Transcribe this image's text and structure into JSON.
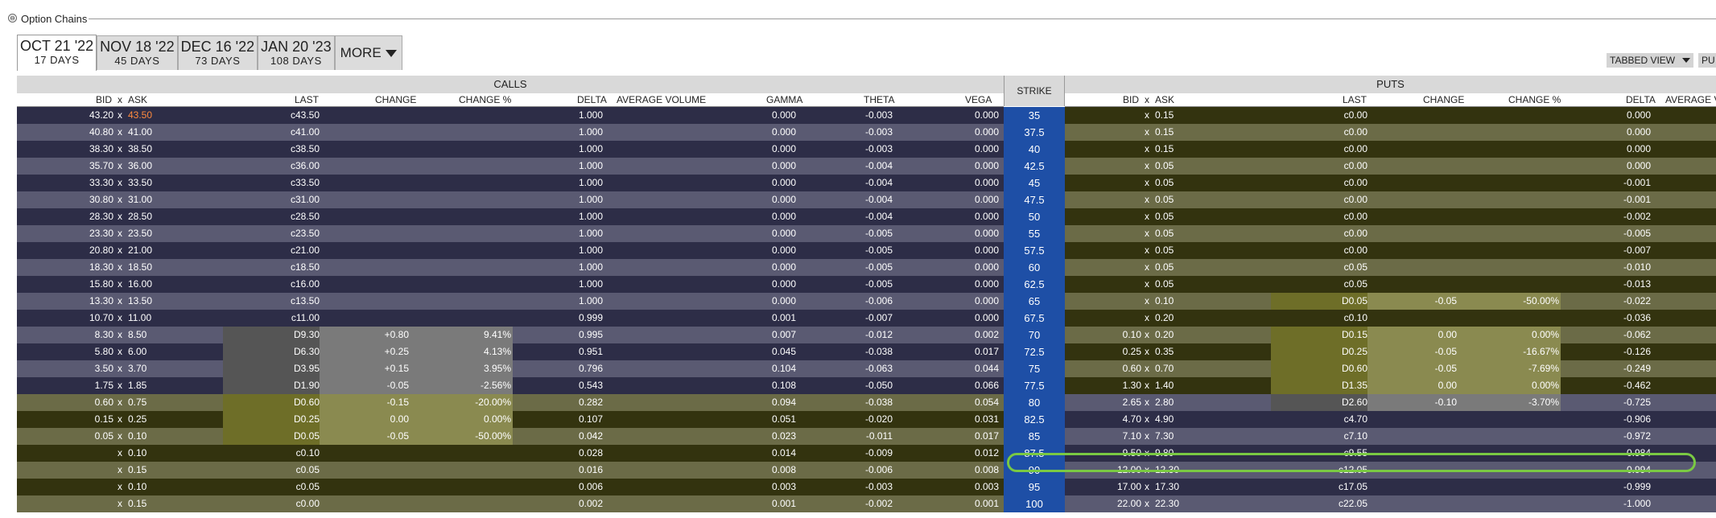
{
  "panel": {
    "title": "Option Chains",
    "collapse_glyph": "⊖"
  },
  "tabs": [
    {
      "date": "OCT 21 '22",
      "days": "17 DAYS",
      "active": true
    },
    {
      "date": "NOV 18 '22",
      "days": "45 DAYS",
      "active": false
    },
    {
      "date": "DEC 16 '22",
      "days": "73 DAYS",
      "active": false
    },
    {
      "date": "JAN 20 '23",
      "days": "108 DAYS",
      "active": false
    }
  ],
  "more_label": "MORE",
  "view_select": {
    "value": "TABBED VIEW",
    "second": "PU"
  },
  "headers": {
    "calls": "CALLS",
    "puts": "PUTS",
    "strike": "STRIKE",
    "bid": "BID",
    "x": "x",
    "ask": "ASK",
    "last": "LAST",
    "change": "CHANGE",
    "change_pct": "CHANGE %",
    "delta": "DELTA",
    "avg_volume": "AVERAGE VOLUME",
    "gamma": "GAMMA",
    "theta": "THETA",
    "vega": "VEGA",
    "puts_avg_volume": "AVERAGE V"
  },
  "colors": {
    "strike": "#1e4fa6",
    "highlight_oval": "#7ac943",
    "ask_highlight": "#ff8a3d"
  },
  "rows": [
    {
      "strike": "35",
      "c": {
        "bid": "43.20",
        "ask": "43.50",
        "last": "c43.50",
        "chg": "",
        "pct": "",
        "delta": "1.000",
        "gamma": "0.000",
        "theta": "-0.003",
        "vega": "0.000"
      },
      "p": {
        "bid": "",
        "ask": "0.15",
        "last": "c0.00",
        "chg": "",
        "pct": "",
        "delta": "0.000"
      }
    },
    {
      "strike": "37.5",
      "c": {
        "bid": "40.80",
        "ask": "41.00",
        "last": "c41.00",
        "chg": "",
        "pct": "",
        "delta": "1.000",
        "gamma": "0.000",
        "theta": "-0.003",
        "vega": "0.000"
      },
      "p": {
        "bid": "",
        "ask": "0.15",
        "last": "c0.00",
        "chg": "",
        "pct": "",
        "delta": "0.000"
      }
    },
    {
      "strike": "40",
      "c": {
        "bid": "38.30",
        "ask": "38.50",
        "last": "c38.50",
        "chg": "",
        "pct": "",
        "delta": "1.000",
        "gamma": "0.000",
        "theta": "-0.003",
        "vega": "0.000"
      },
      "p": {
        "bid": "",
        "ask": "0.15",
        "last": "c0.00",
        "chg": "",
        "pct": "",
        "delta": "0.000"
      }
    },
    {
      "strike": "42.5",
      "c": {
        "bid": "35.70",
        "ask": "36.00",
        "last": "c36.00",
        "chg": "",
        "pct": "",
        "delta": "1.000",
        "gamma": "0.000",
        "theta": "-0.004",
        "vega": "0.000"
      },
      "p": {
        "bid": "",
        "ask": "0.05",
        "last": "c0.00",
        "chg": "",
        "pct": "",
        "delta": "0.000"
      }
    },
    {
      "strike": "45",
      "c": {
        "bid": "33.30",
        "ask": "33.50",
        "last": "c33.50",
        "chg": "",
        "pct": "",
        "delta": "1.000",
        "gamma": "0.000",
        "theta": "-0.004",
        "vega": "0.000"
      },
      "p": {
        "bid": "",
        "ask": "0.05",
        "last": "c0.00",
        "chg": "",
        "pct": "",
        "delta": "-0.001"
      }
    },
    {
      "strike": "47.5",
      "c": {
        "bid": "30.80",
        "ask": "31.00",
        "last": "c31.00",
        "chg": "",
        "pct": "",
        "delta": "1.000",
        "gamma": "0.000",
        "theta": "-0.004",
        "vega": "0.000"
      },
      "p": {
        "bid": "",
        "ask": "0.05",
        "last": "c0.00",
        "chg": "",
        "pct": "",
        "delta": "-0.001"
      }
    },
    {
      "strike": "50",
      "c": {
        "bid": "28.30",
        "ask": "28.50",
        "last": "c28.50",
        "chg": "",
        "pct": "",
        "delta": "1.000",
        "gamma": "0.000",
        "theta": "-0.004",
        "vega": "0.000"
      },
      "p": {
        "bid": "",
        "ask": "0.05",
        "last": "c0.00",
        "chg": "",
        "pct": "",
        "delta": "-0.002"
      }
    },
    {
      "strike": "55",
      "c": {
        "bid": "23.30",
        "ask": "23.50",
        "last": "c23.50",
        "chg": "",
        "pct": "",
        "delta": "1.000",
        "gamma": "0.000",
        "theta": "-0.005",
        "vega": "0.000"
      },
      "p": {
        "bid": "",
        "ask": "0.05",
        "last": "c0.00",
        "chg": "",
        "pct": "",
        "delta": "-0.005"
      }
    },
    {
      "strike": "57.5",
      "c": {
        "bid": "20.80",
        "ask": "21.00",
        "last": "c21.00",
        "chg": "",
        "pct": "",
        "delta": "1.000",
        "gamma": "0.000",
        "theta": "-0.005",
        "vega": "0.000"
      },
      "p": {
        "bid": "",
        "ask": "0.05",
        "last": "c0.00",
        "chg": "",
        "pct": "",
        "delta": "-0.007"
      }
    },
    {
      "strike": "60",
      "c": {
        "bid": "18.30",
        "ask": "18.50",
        "last": "c18.50",
        "chg": "",
        "pct": "",
        "delta": "1.000",
        "gamma": "0.000",
        "theta": "-0.005",
        "vega": "0.000"
      },
      "p": {
        "bid": "",
        "ask": "0.05",
        "last": "c0.05",
        "chg": "",
        "pct": "",
        "delta": "-0.010"
      }
    },
    {
      "strike": "62.5",
      "c": {
        "bid": "15.80",
        "ask": "16.00",
        "last": "c16.00",
        "chg": "",
        "pct": "",
        "delta": "1.000",
        "gamma": "0.000",
        "theta": "-0.005",
        "vega": "0.000"
      },
      "p": {
        "bid": "",
        "ask": "0.05",
        "last": "c0.05",
        "chg": "",
        "pct": "",
        "delta": "-0.013"
      }
    },
    {
      "strike": "65",
      "c": {
        "bid": "13.30",
        "ask": "13.50",
        "last": "c13.50",
        "chg": "",
        "pct": "",
        "delta": "1.000",
        "gamma": "0.000",
        "theta": "-0.006",
        "vega": "0.000"
      },
      "p": {
        "bid": "",
        "ask": "0.10",
        "last": "D0.05",
        "chg": "-0.05",
        "pct": "-50.00%",
        "delta": "-0.022"
      }
    },
    {
      "strike": "67.5",
      "c": {
        "bid": "10.70",
        "ask": "11.00",
        "last": "c11.00",
        "chg": "",
        "pct": "",
        "delta": "0.999",
        "gamma": "0.001",
        "theta": "-0.007",
        "vega": "0.000"
      },
      "p": {
        "bid": "",
        "ask": "0.20",
        "last": "c0.10",
        "chg": "",
        "pct": "",
        "delta": "-0.036"
      }
    },
    {
      "strike": "70",
      "c": {
        "bid": "8.30",
        "ask": "8.50",
        "last": "D9.30",
        "chg": "+0.80",
        "pct": "9.41%",
        "delta": "0.995",
        "gamma": "0.007",
        "theta": "-0.012",
        "vega": "0.002"
      },
      "p": {
        "bid": "0.10",
        "ask": "0.20",
        "last": "D0.15",
        "chg": "0.00",
        "pct": "0.00%",
        "delta": "-0.062"
      }
    },
    {
      "strike": "72.5",
      "c": {
        "bid": "5.80",
        "ask": "6.00",
        "last": "D6.30",
        "chg": "+0.25",
        "pct": "4.13%",
        "delta": "0.951",
        "gamma": "0.045",
        "theta": "-0.038",
        "vega": "0.017"
      },
      "p": {
        "bid": "0.25",
        "ask": "0.35",
        "last": "D0.25",
        "chg": "-0.05",
        "pct": "-16.67%",
        "delta": "-0.126"
      }
    },
    {
      "strike": "75",
      "c": {
        "bid": "3.50",
        "ask": "3.70",
        "last": "D3.95",
        "chg": "+0.15",
        "pct": "3.95%",
        "delta": "0.796",
        "gamma": "0.104",
        "theta": "-0.063",
        "vega": "0.044"
      },
      "p": {
        "bid": "0.60",
        "ask": "0.70",
        "last": "D0.60",
        "chg": "-0.05",
        "pct": "-7.69%",
        "delta": "-0.249"
      }
    },
    {
      "strike": "77.5",
      "c": {
        "bid": "1.75",
        "ask": "1.85",
        "last": "D1.90",
        "chg": "-0.05",
        "pct": "-2.56%",
        "delta": "0.543",
        "gamma": "0.108",
        "theta": "-0.050",
        "vega": "0.066"
      },
      "p": {
        "bid": "1.30",
        "ask": "1.40",
        "last": "D1.35",
        "chg": "0.00",
        "pct": "0.00%",
        "delta": "-0.462"
      }
    },
    {
      "strike": "80",
      "c": {
        "bid": "0.60",
        "ask": "0.75",
        "last": "D0.60",
        "chg": "-0.15",
        "pct": "-20.00%",
        "delta": "0.282",
        "gamma": "0.094",
        "theta": "-0.038",
        "vega": "0.054"
      },
      "p": {
        "bid": "2.65",
        "ask": "2.80",
        "last": "D2.60",
        "chg": "-0.10",
        "pct": "-3.70%",
        "delta": "-0.725"
      }
    },
    {
      "strike": "82.5",
      "c": {
        "bid": "0.15",
        "ask": "0.25",
        "last": "D0.25",
        "chg": "0.00",
        "pct": "0.00%",
        "delta": "0.107",
        "gamma": "0.051",
        "theta": "-0.020",
        "vega": "0.031"
      },
      "p": {
        "bid": "4.70",
        "ask": "4.90",
        "last": "c4.70",
        "chg": "",
        "pct": "",
        "delta": "-0.906"
      }
    },
    {
      "strike": "85",
      "c": {
        "bid": "0.05",
        "ask": "0.10",
        "last": "D0.05",
        "chg": "-0.05",
        "pct": "-50.00%",
        "delta": "0.042",
        "gamma": "0.023",
        "theta": "-0.011",
        "vega": "0.017"
      },
      "p": {
        "bid": "7.10",
        "ask": "7.30",
        "last": "c7.10",
        "chg": "",
        "pct": "",
        "delta": "-0.972"
      }
    },
    {
      "strike": "87.5",
      "c": {
        "bid": "",
        "ask": "0.10",
        "last": "c0.10",
        "chg": "",
        "pct": "",
        "delta": "0.028",
        "gamma": "0.014",
        "theta": "-0.009",
        "vega": "0.012"
      },
      "p": {
        "bid": "9.50",
        "ask": "9.80",
        "last": "c9.55",
        "chg": "",
        "pct": "",
        "delta": "-0.984"
      }
    },
    {
      "strike": "90",
      "c": {
        "bid": "",
        "ask": "0.15",
        "last": "c0.05",
        "chg": "",
        "pct": "",
        "delta": "0.016",
        "gamma": "0.008",
        "theta": "-0.006",
        "vega": "0.008"
      },
      "p": {
        "bid": "12.00",
        "ask": "12.30",
        "last": "c12.05",
        "chg": "",
        "pct": "",
        "delta": "-0.994"
      }
    },
    {
      "strike": "95",
      "c": {
        "bid": "",
        "ask": "0.10",
        "last": "c0.05",
        "chg": "",
        "pct": "",
        "delta": "0.006",
        "gamma": "0.003",
        "theta": "-0.003",
        "vega": "0.003"
      },
      "p": {
        "bid": "17.00",
        "ask": "17.30",
        "last": "c17.05",
        "chg": "",
        "pct": "",
        "delta": "-0.999"
      }
    },
    {
      "strike": "100",
      "c": {
        "bid": "",
        "ask": "0.15",
        "last": "c0.00",
        "chg": "",
        "pct": "",
        "delta": "0.002",
        "gamma": "0.001",
        "theta": "-0.002",
        "vega": "0.001"
      },
      "p": {
        "bid": "22.00",
        "ask": "22.30",
        "last": "c22.05",
        "chg": "",
        "pct": "",
        "delta": "-1.000"
      }
    }
  ]
}
